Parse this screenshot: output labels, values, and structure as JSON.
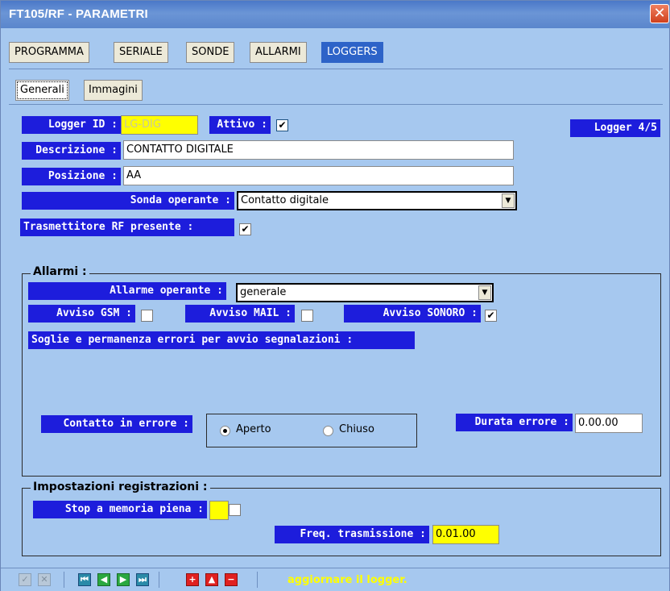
{
  "window": {
    "title": "FT105/RF - PARAMETRI",
    "close_glyph": "✕"
  },
  "tabs": [
    {
      "label": "PROGRAMMA",
      "active": false
    },
    {
      "label": "SERIALE",
      "active": false
    },
    {
      "label": "SONDE",
      "active": false
    },
    {
      "label": "ALLARMI",
      "active": false
    },
    {
      "label": "LOGGERS",
      "active": true
    }
  ],
  "subtabs": [
    {
      "label": "Generali",
      "active": true
    },
    {
      "label": "Immagini",
      "active": false
    }
  ],
  "general": {
    "logger_id_label": "Logger ID :",
    "logger_id_value": "LG-DIG",
    "attivo_label": "Attivo :",
    "attivo_checked": true,
    "logger_counter": "Logger 4/5",
    "descrizione_label": "Descrizione :",
    "descrizione_value": "CONTATTO DIGITALE",
    "posizione_label": "Posizione :",
    "posizione_value": "AA",
    "sonda_label": "Sonda operante :",
    "sonda_value": "Contatto digitale",
    "rf_label": "Trasmettitore RF presente :",
    "rf_checked": true
  },
  "allarmi": {
    "group_title": "Allarmi :",
    "allarme_label": "Allarme operante :",
    "allarme_value": "generale",
    "gsm_label": "Avviso GSM :",
    "gsm_checked": false,
    "mail_label": "Avviso MAIL :",
    "mail_checked": false,
    "sonoro_label": "Avviso SONORO :",
    "sonoro_checked": true,
    "soglie_label": "Soglie e permanenza errori per avvio segnalazioni :",
    "contatto_label": "Contatto in errore :",
    "radio_aperto": "Aperto",
    "radio_chiuso": "Chiuso",
    "selected": "Aperto",
    "durata_label": "Durata errore :",
    "durata_value": "0.00.00"
  },
  "registrazioni": {
    "group_title": "Impostazioni registrazioni :",
    "stop_label": "Stop a memoria piena :",
    "stop_checked": false,
    "freq_label": "Freq. trasmissione :",
    "freq_value": "0.01.00"
  },
  "toolbar": {
    "icons": [
      "confirm-icon",
      "cancel-icon",
      "first-record-icon",
      "prev-record-icon",
      "next-record-icon",
      "last-record-icon",
      "add-record-icon",
      "move-up-icon",
      "delete-record-icon"
    ],
    "status_text": "aggiornare il logger."
  },
  "check_glyph": "✔",
  "colors": {
    "window_bg": "#a6c8ef",
    "label_bg": "#1d1ddc",
    "active_tab": "#2d63c8",
    "highlight_field": "#ffff00",
    "status_text": "#ffff00"
  }
}
